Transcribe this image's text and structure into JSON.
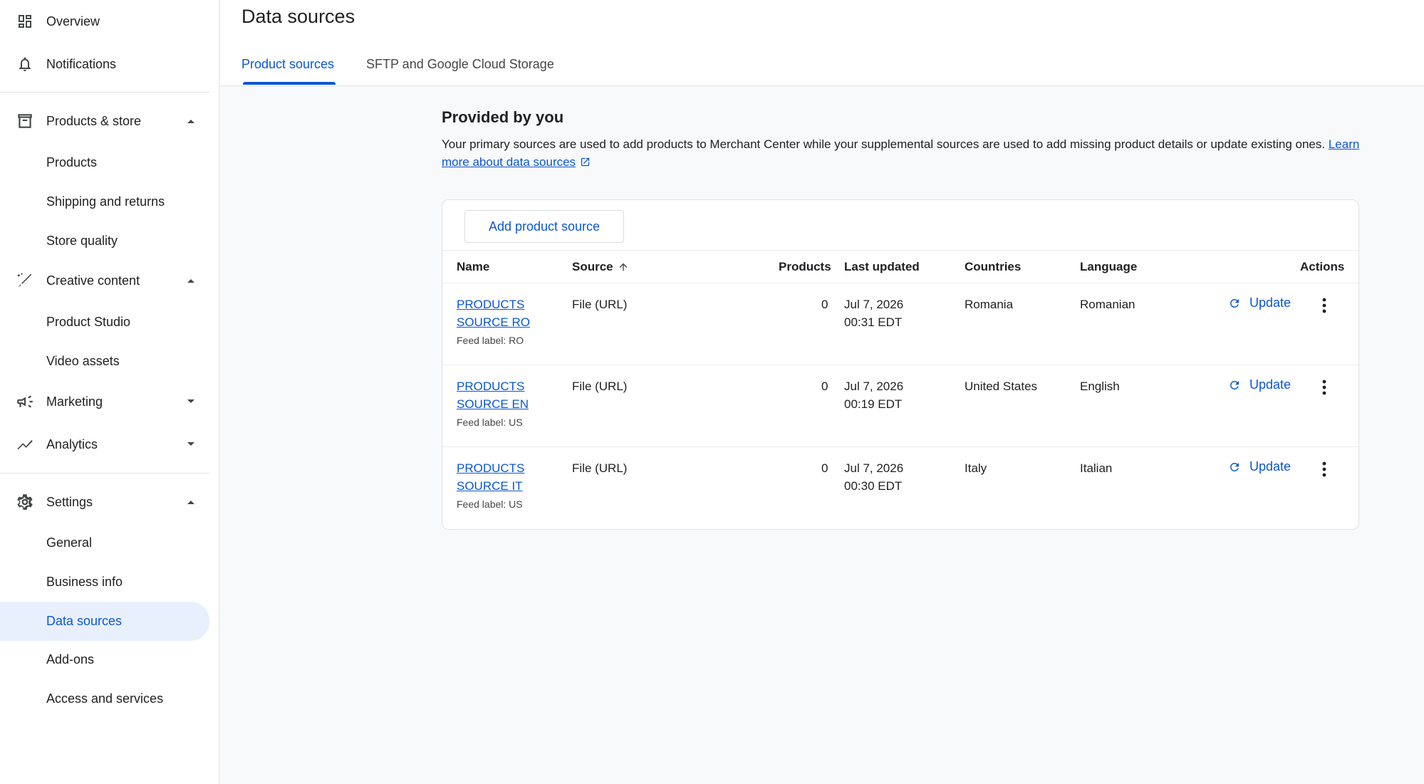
{
  "sidebar": {
    "top_items": [
      {
        "label": "Overview",
        "icon": "dashboard-icon"
      },
      {
        "label": "Notifications",
        "icon": "bell-icon"
      }
    ],
    "groups": {
      "products_store": {
        "label": "Products & store",
        "icon": "store-icon",
        "expanded": true,
        "items": [
          "Products",
          "Shipping and returns",
          "Store quality"
        ]
      },
      "creative_content": {
        "label": "Creative content",
        "icon": "magic-pen-icon",
        "expanded": true,
        "items": [
          "Product Studio",
          "Video assets"
        ]
      },
      "marketing": {
        "label": "Marketing",
        "icon": "megaphone-icon",
        "expanded": false
      },
      "analytics": {
        "label": "Analytics",
        "icon": "trend-icon",
        "expanded": false
      },
      "settings": {
        "label": "Settings",
        "icon": "gear-icon",
        "expanded": true,
        "items": [
          "General",
          "Business info",
          "Data sources",
          "Add-ons",
          "Access and services"
        ],
        "active_item": "Data sources"
      }
    }
  },
  "header": {
    "title": "Data sources",
    "tabs": [
      {
        "label": "Product sources",
        "active": true
      },
      {
        "label": "SFTP and Google Cloud Storage",
        "active": false
      }
    ]
  },
  "section": {
    "title": "Provided by you",
    "description": "Your primary sources are used to add products to Merchant Center while your supplemental sources are used to add missing product details or update existing ones.",
    "learn_more_link": "Learn more about data sources"
  },
  "table": {
    "add_button_label": "Add product source",
    "columns": {
      "name": "Name",
      "source": "Source",
      "products": "Products",
      "last_updated": "Last updated",
      "countries": "Countries",
      "language": "Language",
      "actions": "Actions"
    },
    "update_label": "Update",
    "rows": [
      {
        "name": "PRODUCTS SOURCE RO",
        "feed_label": "Feed label: RO",
        "source": "File (URL)",
        "products": "0",
        "last_updated_date": "Jul 7, 2026",
        "last_updated_time": "00:31 EDT",
        "country": "Romania",
        "language": "Romanian"
      },
      {
        "name": "PRODUCTS SOURCE EN",
        "feed_label": "Feed label: US",
        "source": "File (URL)",
        "products": "0",
        "last_updated_date": "Jul 7, 2026",
        "last_updated_time": "00:19 EDT",
        "country": "United States",
        "language": "English"
      },
      {
        "name": "PRODUCTS SOURCE IT",
        "feed_label": "Feed label: US",
        "source": "File (URL)",
        "products": "0",
        "last_updated_date": "Jul 7, 2026",
        "last_updated_time": "00:30 EDT",
        "country": "Italy",
        "language": "Italian"
      }
    ]
  },
  "colors": {
    "accent": "#0b57d0",
    "active_nav_bg": "#e8f0fe",
    "background": "#f8f9fa",
    "text": "#202124"
  }
}
